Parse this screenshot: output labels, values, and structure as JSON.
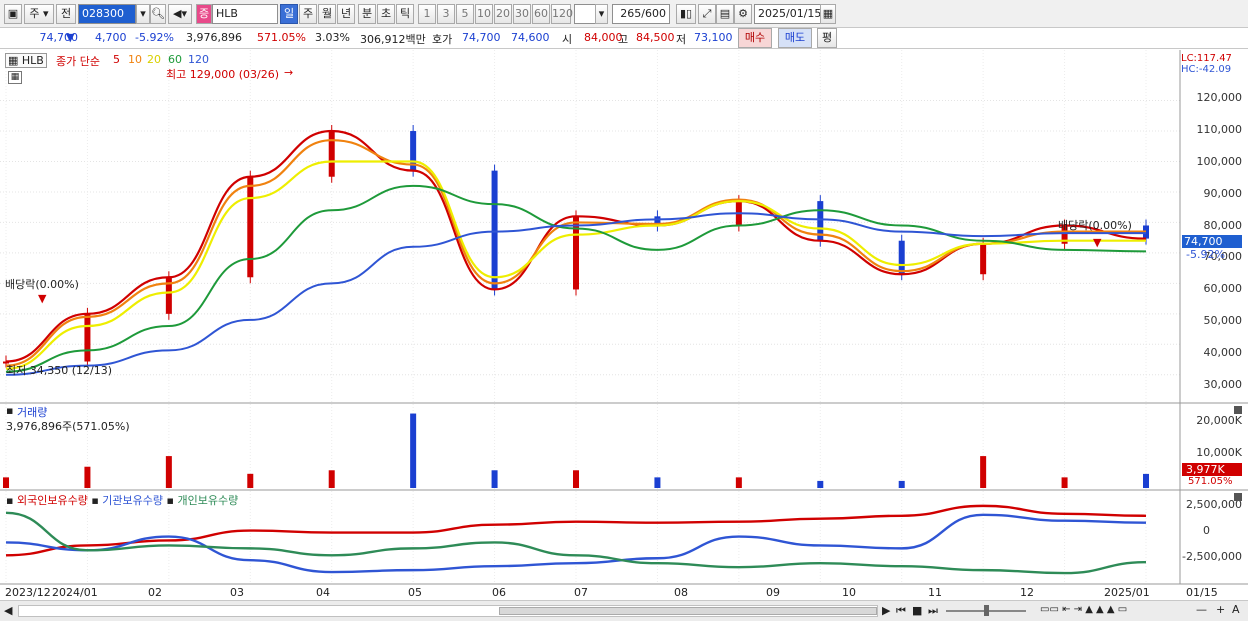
{
  "toolbar": {
    "market": "주",
    "prev_label": "전",
    "code": "028300",
    "name": "HLB",
    "periods": [
      "일",
      "주",
      "월",
      "년",
      "분",
      "초",
      "틱"
    ],
    "active_period": "일",
    "intervals": [
      "1",
      "3",
      "5",
      "10",
      "20",
      "30",
      "60",
      "120"
    ],
    "count": "265",
    "count_total": "/600",
    "date": "2025/01/15"
  },
  "quote": {
    "price": "74,700",
    "change": "4,700",
    "change_pct": "-5.92%",
    "volume": "3,976,896",
    "vol_ratio": "571.05%",
    "turnover": "3.03%",
    "amount": "306,912백만",
    "bid_label": "호가",
    "ask": "74,700",
    "bid": "74,600",
    "open_label": "시",
    "open": "84,000",
    "high_label": "고",
    "high": "84,500",
    "low_label": "저",
    "low": "73,100",
    "buy_label": "매수",
    "sell_label": "매도",
    "eval_label": "평"
  },
  "price_panel": {
    "name": "HLB",
    "ma_title": "종가 단순",
    "ma_periods": [
      "5",
      "10",
      "20",
      "60",
      "120"
    ],
    "ma_colors": [
      "#d00000",
      "#f0820f",
      "#eeee00",
      "#1e9a3a",
      "#2f55d4"
    ],
    "lc": "LC:117.47",
    "hc": "HC:-42.09",
    "y_ticks": [
      "120,000",
      "110,000",
      "100,000",
      "90,000",
      "80,000",
      "70,000",
      "60,000",
      "50,000",
      "40,000",
      "30,000"
    ],
    "max_label": "최고 129,000 (03/26)",
    "min_label": "최저 34,350 (12/13)",
    "dividend_left": "배당락(0.00%)",
    "dividend_right": "배당락(0.00%)",
    "last_price_tag": "74,700",
    "last_pct_tag": "-5.92%"
  },
  "volume_panel": {
    "title": "거래량",
    "value": "3,976,896주(571.05%)",
    "y_ticks": [
      "20,000K",
      "10,000K"
    ],
    "tag_value": "3,977K",
    "tag_pct": "571.05%"
  },
  "holdings_panel": {
    "series": [
      "외국인보유수량",
      "기관보유수량",
      "개인보유수량"
    ],
    "colors": [
      "#d00000",
      "#2f55d4",
      "#2e8b57"
    ],
    "y_ticks": [
      "2,500,000",
      "0",
      "-2,500,000"
    ]
  },
  "x_axis": {
    "labels": [
      "2023/12",
      "2024/01",
      "02",
      "03",
      "04",
      "05",
      "06",
      "07",
      "08",
      "09",
      "10",
      "11",
      "12",
      "2025/01",
      "01/15"
    ]
  },
  "chart_data": {
    "type": "line",
    "title": "",
    "y_range": [
      25000,
      132000
    ],
    "x": [
      "2023/12",
      "2024/01",
      "02",
      "03",
      "04",
      "05",
      "06",
      "07",
      "08",
      "09",
      "10",
      "11",
      "12",
      "2025/01",
      "01/15"
    ],
    "close": [
      34350,
      50000,
      62000,
      95000,
      110000,
      97000,
      58000,
      82000,
      79000,
      87000,
      74000,
      63000,
      73000,
      79000,
      74700
    ],
    "series": [
      {
        "name": "5",
        "values": [
          34350,
          50000,
          62000,
          95000,
          110000,
          97000,
          58000,
          82000,
          79000,
          87000,
          74000,
          63000,
          73000,
          79000,
          74700
        ]
      },
      {
        "name": "10",
        "values": [
          33000,
          49000,
          60000,
          92000,
          107000,
          99000,
          60000,
          80000,
          79500,
          87500,
          76000,
          64000,
          73000,
          77000,
          77000
        ]
      },
      {
        "name": "20",
        "values": [
          32000,
          46000,
          57000,
          88000,
          100000,
          100000,
          62000,
          76000,
          79000,
          87000,
          78000,
          66000,
          73000,
          74000,
          74000
        ]
      },
      {
        "name": "60",
        "values": [
          31000,
          38000,
          46000,
          68000,
          84000,
          92000,
          86000,
          78000,
          71000,
          79000,
          84000,
          79000,
          74000,
          71000,
          70500
        ]
      },
      {
        "name": "120",
        "values": [
          30000,
          33000,
          38000,
          48000,
          60000,
          72000,
          77000,
          79000,
          81000,
          83000,
          81000,
          77000,
          75500,
          76500,
          76500
        ]
      }
    ],
    "volume_k": [
      3000,
      6000,
      9000,
      4000,
      5000,
      21000,
      5000,
      5000,
      3000,
      3000,
      2000,
      2000,
      9000,
      3000,
      3977
    ],
    "holdings": [
      {
        "name": "외국인보유수량",
        "values": [
          -2500000,
          -1500000,
          -1000000,
          0,
          -200000,
          -200000,
          600000,
          900000,
          800000,
          900000,
          1200000,
          1500000,
          2500000,
          1700000,
          1500000
        ]
      },
      {
        "name": "기관보유수량",
        "values": [
          -1200000,
          -2000000,
          -600000,
          -3000000,
          -4200000,
          -4000000,
          -3600000,
          -3300000,
          -2800000,
          -600000,
          -1500000,
          -1800000,
          1600000,
          1000000,
          800000
        ]
      },
      {
        "name": "개인보유수량",
        "values": [
          1800000,
          -2000000,
          -1500000,
          -1800000,
          -2500000,
          -1800000,
          -1200000,
          -2500000,
          -3300000,
          -3700000,
          -3300000,
          -3600000,
          -4000000,
          -4300000,
          -3200000
        ]
      }
    ]
  }
}
